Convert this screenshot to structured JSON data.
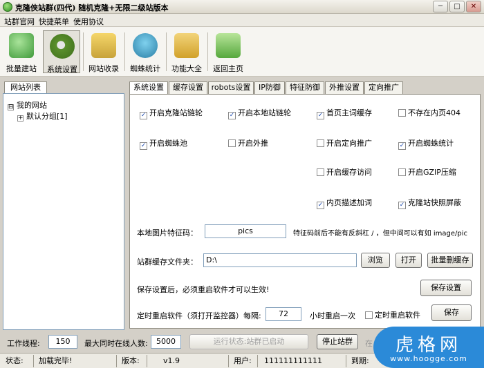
{
  "window": {
    "title": "克隆侠站群(四代) 随机克隆+无限二级站版本",
    "minimize": "─",
    "maximize": "□",
    "close": "✕"
  },
  "menu": [
    "站群官网",
    "快捷菜单",
    "使用协议"
  ],
  "toolbar": [
    {
      "label": "批量建站",
      "icon": "batch-site-icon",
      "color": "#3f9a3a"
    },
    {
      "label": "系统设置",
      "icon": "gear-icon",
      "color": "#5a8f2c"
    },
    {
      "label": "网站收录",
      "icon": "folder-icon",
      "color": "#c8a33a"
    },
    {
      "label": "蜘蛛统计",
      "icon": "spider-icon",
      "color": "#2a7fa6"
    },
    {
      "label": "功能大全",
      "icon": "toolbox-icon",
      "color": "#d1a12a"
    },
    {
      "label": "返回主页",
      "icon": "home-icon",
      "color": "#56a83d"
    }
  ],
  "left_panel": {
    "tab": "网站列表",
    "tree": {
      "root": "我的网站",
      "root_toggle": "⊟",
      "child": "默认分组[1]",
      "child_toggle": "+"
    }
  },
  "tabs": [
    "系统设置",
    "缓存设置",
    "robots设置",
    "IP防御",
    "特征防御",
    "外推设置",
    "定向推广"
  ],
  "checkboxes": [
    {
      "label": "开启克隆站链轮",
      "checked": true
    },
    {
      "label": "开启本地站链轮",
      "checked": true
    },
    {
      "label": "首页主词缓存",
      "checked": true
    },
    {
      "label": "不存在内页404",
      "checked": false
    },
    {
      "label": "开启蜘蛛池",
      "checked": true
    },
    {
      "label": "开启外推",
      "checked": false
    },
    {
      "label": "开启定向推广",
      "checked": false
    },
    {
      "label": "开启蜘蛛统计",
      "checked": true
    },
    {
      "label": "开启缓存访问",
      "checked": false
    },
    {
      "label": "开启GZIP压缩",
      "checked": false
    },
    {
      "label": "内页描述加词",
      "checked": true
    },
    {
      "label": "克隆站快照屏蔽",
      "checked": true
    }
  ],
  "image_code": {
    "label": "本地图片特征码：",
    "value": "pics",
    "hint": "特征码前后不能有反斜杠 / ，但中间可以有如 image/pic"
  },
  "cache_folder": {
    "label": "站群缓存文件夹：",
    "value": "D:\\",
    "browse": "浏览",
    "open": "打开",
    "batch_delete": "批量删缓存"
  },
  "save_notice": "保存设置后，必须重启软件才可以生效!",
  "save_settings": "保存设置",
  "restart": {
    "label": "定时重启软件（须打开监控器）",
    "interval_label": "每隔:",
    "hours": "72",
    "unit_text": "小时重启一次",
    "checkbox_label": "定时重启软件",
    "checked": false,
    "save": "保存"
  },
  "bottom": {
    "threads_label": "工作线程:",
    "threads": "150",
    "max_online_label": "最大同时在线人数:",
    "max_online": "5000",
    "run_status": "运行状态:站群已启动",
    "stop": "停止站群",
    "extra": "在"
  },
  "status": {
    "state_label": "状态:",
    "state": "加载完毕!",
    "version_label": "版本:",
    "version": "v1.9",
    "user_label": "用户:",
    "user": "111111111111",
    "expire_label": "到期:"
  },
  "watermark": {
    "main": "虎格网",
    "sub": "www.hoogge.com"
  }
}
